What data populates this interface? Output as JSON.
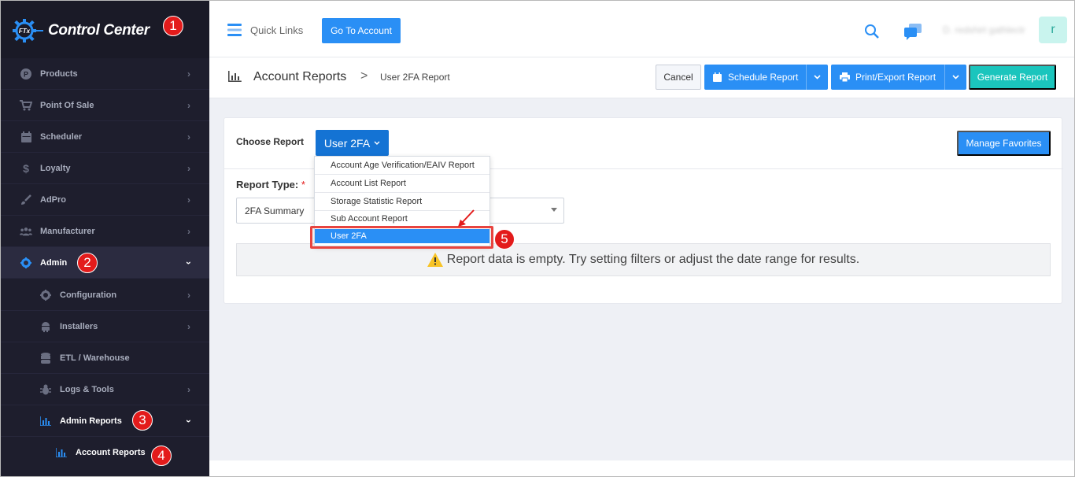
{
  "brand": {
    "logo_text": "Control Center",
    "logo_mark": "FTx"
  },
  "sidebar": {
    "items": [
      {
        "label": "Products",
        "icon": "circle-p-icon"
      },
      {
        "label": "Point Of Sale",
        "icon": "cart-icon"
      },
      {
        "label": "Scheduler",
        "icon": "calendar-icon"
      },
      {
        "label": "Loyalty",
        "icon": "dollar-icon"
      },
      {
        "label": "AdPro",
        "icon": "brush-icon"
      },
      {
        "label": "Manufacturer",
        "icon": "users-icon"
      },
      {
        "label": "Admin",
        "icon": "gear-icon"
      },
      {
        "label": "Configuration",
        "icon": "gear-icon"
      },
      {
        "label": "Installers",
        "icon": "android-icon"
      },
      {
        "label": "ETL / Warehouse",
        "icon": "database-icon"
      },
      {
        "label": "Logs & Tools",
        "icon": "bug-icon"
      },
      {
        "label": "Admin Reports",
        "icon": "bar-chart-icon"
      },
      {
        "label": "Account Reports",
        "icon": "bar-chart-icon"
      }
    ]
  },
  "annotations": [
    "1",
    "2",
    "3",
    "4",
    "5"
  ],
  "topbar": {
    "quick_links": "Quick Links",
    "go_to_account": "Go To Account",
    "username": "D. redshirt gathlectr",
    "avatar_letter": "r"
  },
  "pagebar": {
    "title": "Account Reports",
    "separator": ">",
    "crumb": "User 2FA Report",
    "cancel": "Cancel",
    "schedule": "Schedule Report",
    "print": "Print/Export Report",
    "generate": "Generate Report"
  },
  "card": {
    "choose_label": "Choose Report",
    "choose_value": "User 2FA",
    "manage_favorites": "Manage Favorites",
    "report_type_label": "Report Type:",
    "required_mark": "*",
    "report_type_value": "2FA Summary",
    "empty_message": "Report data is empty. Try setting filters or adjust the date range for results."
  },
  "dropdown": {
    "items": [
      "Account Age Verification/EAIV Report",
      "Account List Report",
      "Storage Statistic Report",
      "Sub Account Report",
      "User 2FA"
    ],
    "selected_index": 4
  },
  "colors": {
    "sidebar_bg": "#1e1e2d",
    "primary": "#2a8ff5",
    "success": "#1bc5bd",
    "annotation": "#e31b1b"
  }
}
